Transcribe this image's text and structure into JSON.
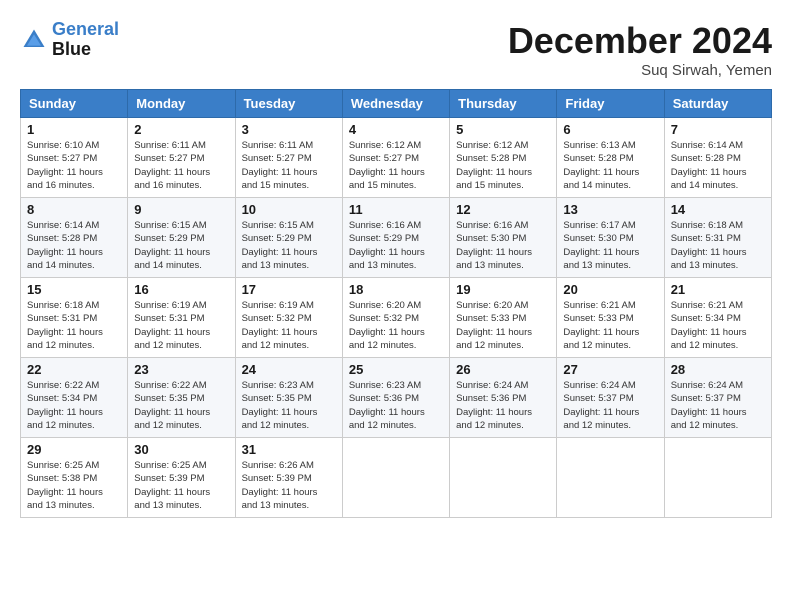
{
  "logo": {
    "line1": "General",
    "line2": "Blue"
  },
  "title": "December 2024",
  "location": "Suq Sirwah, Yemen",
  "days_header": [
    "Sunday",
    "Monday",
    "Tuesday",
    "Wednesday",
    "Thursday",
    "Friday",
    "Saturday"
  ],
  "weeks": [
    [
      {
        "day": "1",
        "sunrise": "6:10 AM",
        "sunset": "5:27 PM",
        "daylight": "11 hours and 16 minutes."
      },
      {
        "day": "2",
        "sunrise": "6:11 AM",
        "sunset": "5:27 PM",
        "daylight": "11 hours and 16 minutes."
      },
      {
        "day": "3",
        "sunrise": "6:11 AM",
        "sunset": "5:27 PM",
        "daylight": "11 hours and 15 minutes."
      },
      {
        "day": "4",
        "sunrise": "6:12 AM",
        "sunset": "5:27 PM",
        "daylight": "11 hours and 15 minutes."
      },
      {
        "day": "5",
        "sunrise": "6:12 AM",
        "sunset": "5:28 PM",
        "daylight": "11 hours and 15 minutes."
      },
      {
        "day": "6",
        "sunrise": "6:13 AM",
        "sunset": "5:28 PM",
        "daylight": "11 hours and 14 minutes."
      },
      {
        "day": "7",
        "sunrise": "6:14 AM",
        "sunset": "5:28 PM",
        "daylight": "11 hours and 14 minutes."
      }
    ],
    [
      {
        "day": "8",
        "sunrise": "6:14 AM",
        "sunset": "5:28 PM",
        "daylight": "11 hours and 14 minutes."
      },
      {
        "day": "9",
        "sunrise": "6:15 AM",
        "sunset": "5:29 PM",
        "daylight": "11 hours and 14 minutes."
      },
      {
        "day": "10",
        "sunrise": "6:15 AM",
        "sunset": "5:29 PM",
        "daylight": "11 hours and 13 minutes."
      },
      {
        "day": "11",
        "sunrise": "6:16 AM",
        "sunset": "5:29 PM",
        "daylight": "11 hours and 13 minutes."
      },
      {
        "day": "12",
        "sunrise": "6:16 AM",
        "sunset": "5:30 PM",
        "daylight": "11 hours and 13 minutes."
      },
      {
        "day": "13",
        "sunrise": "6:17 AM",
        "sunset": "5:30 PM",
        "daylight": "11 hours and 13 minutes."
      },
      {
        "day": "14",
        "sunrise": "6:18 AM",
        "sunset": "5:31 PM",
        "daylight": "11 hours and 13 minutes."
      }
    ],
    [
      {
        "day": "15",
        "sunrise": "6:18 AM",
        "sunset": "5:31 PM",
        "daylight": "11 hours and 12 minutes."
      },
      {
        "day": "16",
        "sunrise": "6:19 AM",
        "sunset": "5:31 PM",
        "daylight": "11 hours and 12 minutes."
      },
      {
        "day": "17",
        "sunrise": "6:19 AM",
        "sunset": "5:32 PM",
        "daylight": "11 hours and 12 minutes."
      },
      {
        "day": "18",
        "sunrise": "6:20 AM",
        "sunset": "5:32 PM",
        "daylight": "11 hours and 12 minutes."
      },
      {
        "day": "19",
        "sunrise": "6:20 AM",
        "sunset": "5:33 PM",
        "daylight": "11 hours and 12 minutes."
      },
      {
        "day": "20",
        "sunrise": "6:21 AM",
        "sunset": "5:33 PM",
        "daylight": "11 hours and 12 minutes."
      },
      {
        "day": "21",
        "sunrise": "6:21 AM",
        "sunset": "5:34 PM",
        "daylight": "11 hours and 12 minutes."
      }
    ],
    [
      {
        "day": "22",
        "sunrise": "6:22 AM",
        "sunset": "5:34 PM",
        "daylight": "11 hours and 12 minutes."
      },
      {
        "day": "23",
        "sunrise": "6:22 AM",
        "sunset": "5:35 PM",
        "daylight": "11 hours and 12 minutes."
      },
      {
        "day": "24",
        "sunrise": "6:23 AM",
        "sunset": "5:35 PM",
        "daylight": "11 hours and 12 minutes."
      },
      {
        "day": "25",
        "sunrise": "6:23 AM",
        "sunset": "5:36 PM",
        "daylight": "11 hours and 12 minutes."
      },
      {
        "day": "26",
        "sunrise": "6:24 AM",
        "sunset": "5:36 PM",
        "daylight": "11 hours and 12 minutes."
      },
      {
        "day": "27",
        "sunrise": "6:24 AM",
        "sunset": "5:37 PM",
        "daylight": "11 hours and 12 minutes."
      },
      {
        "day": "28",
        "sunrise": "6:24 AM",
        "sunset": "5:37 PM",
        "daylight": "11 hours and 12 minutes."
      }
    ],
    [
      {
        "day": "29",
        "sunrise": "6:25 AM",
        "sunset": "5:38 PM",
        "daylight": "11 hours and 13 minutes."
      },
      {
        "day": "30",
        "sunrise": "6:25 AM",
        "sunset": "5:39 PM",
        "daylight": "11 hours and 13 minutes."
      },
      {
        "day": "31",
        "sunrise": "6:26 AM",
        "sunset": "5:39 PM",
        "daylight": "11 hours and 13 minutes."
      },
      null,
      null,
      null,
      null
    ]
  ]
}
